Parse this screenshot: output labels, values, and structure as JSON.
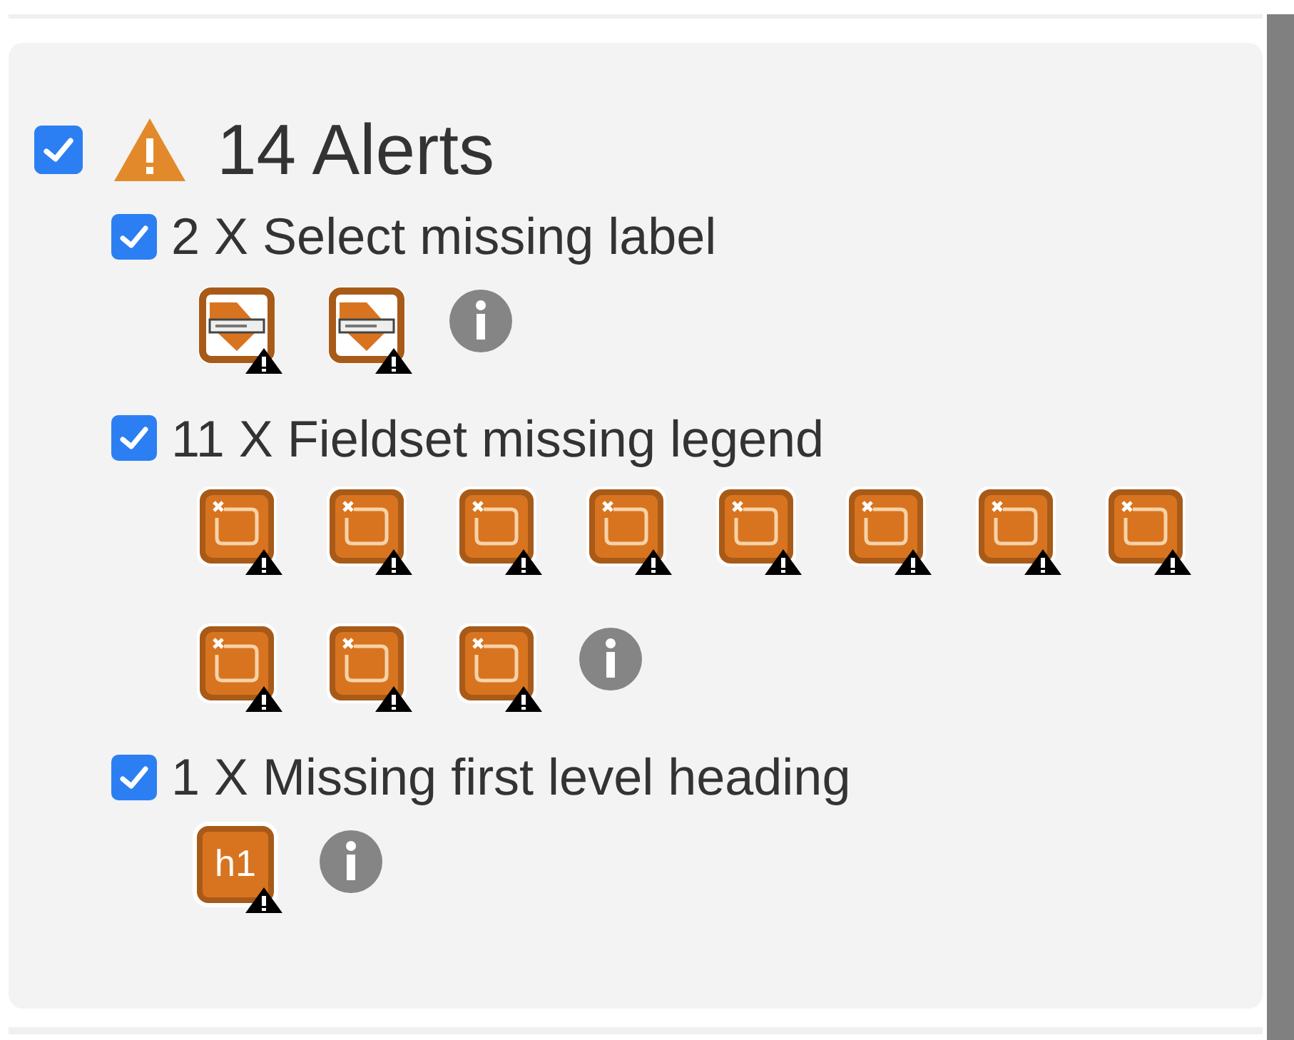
{
  "alerts": {
    "checked": true,
    "title": "14 Alerts",
    "groups": [
      {
        "checked": true,
        "label": "2 X Select missing label",
        "items": [
          {
            "kind": "select"
          },
          {
            "kind": "select"
          }
        ]
      },
      {
        "checked": true,
        "label": "11 X Fieldset missing legend",
        "items": [
          {
            "kind": "fieldset"
          },
          {
            "kind": "fieldset"
          },
          {
            "kind": "fieldset"
          },
          {
            "kind": "fieldset"
          },
          {
            "kind": "fieldset"
          },
          {
            "kind": "fieldset"
          },
          {
            "kind": "fieldset"
          },
          {
            "kind": "fieldset"
          },
          {
            "kind": "fieldset"
          },
          {
            "kind": "fieldset"
          },
          {
            "kind": "fieldset"
          }
        ]
      },
      {
        "checked": true,
        "label": "1 X Missing first level heading",
        "items": [
          {
            "kind": "heading",
            "text": "h1"
          }
        ]
      }
    ]
  }
}
